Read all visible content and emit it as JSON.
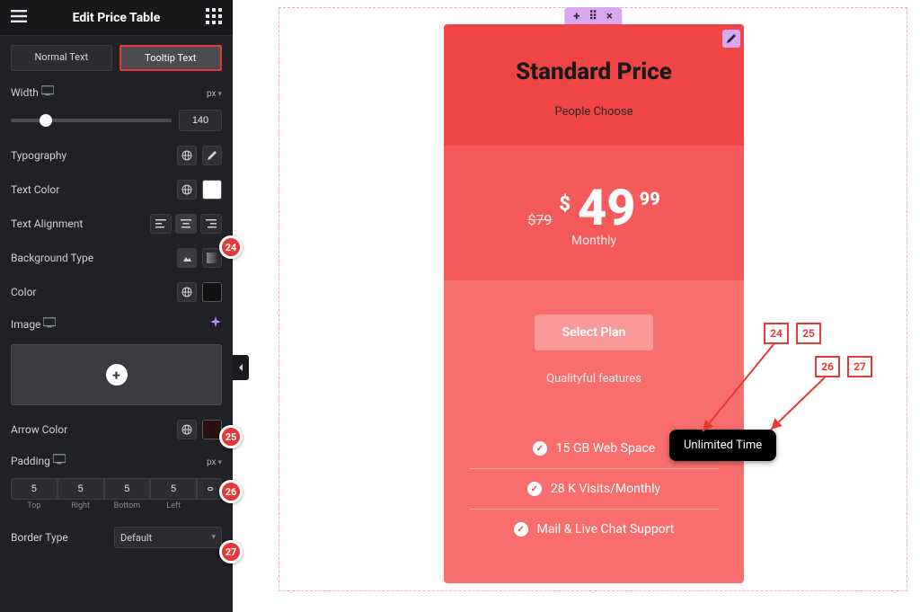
{
  "sidebar": {
    "title": "Edit Price Table",
    "tabs": {
      "normal": "Normal Text",
      "tooltip": "Tooltip Text"
    },
    "width": {
      "label": "Width",
      "unit": "px",
      "value": "140"
    },
    "typography": "Typography",
    "textColor": "Text Color",
    "textAlign": "Text Alignment",
    "bgType": "Background Type",
    "color": "Color",
    "image": "Image",
    "arrowColor": "Arrow Color",
    "padding": {
      "label": "Padding",
      "unit": "px",
      "top": "5",
      "right": "5",
      "bottom": "5",
      "left": "5",
      "lblTop": "Top",
      "lblRight": "Right",
      "lblBottom": "Bottom",
      "lblLeft": "Left"
    },
    "borderType": {
      "label": "Border Type",
      "value": "Default"
    }
  },
  "badges": {
    "b24": "24",
    "b25": "25",
    "b26": "26",
    "b27": "27"
  },
  "legend": {
    "l24": "24",
    "l25": "25",
    "l26": "26",
    "l27": "27"
  },
  "price": {
    "title": "Standard Price",
    "subtitle": "People Choose",
    "old": "$79",
    "currency": "$",
    "amount": "49",
    "cents": "99",
    "period": "Monthly",
    "cta": "Select Plan",
    "tagline": "Qualityful features",
    "features": [
      "15 GB Web Space",
      "28 K Visits/Monthly",
      "Mail & Live Chat Support"
    ]
  },
  "tooltip": "Unlimited Time"
}
